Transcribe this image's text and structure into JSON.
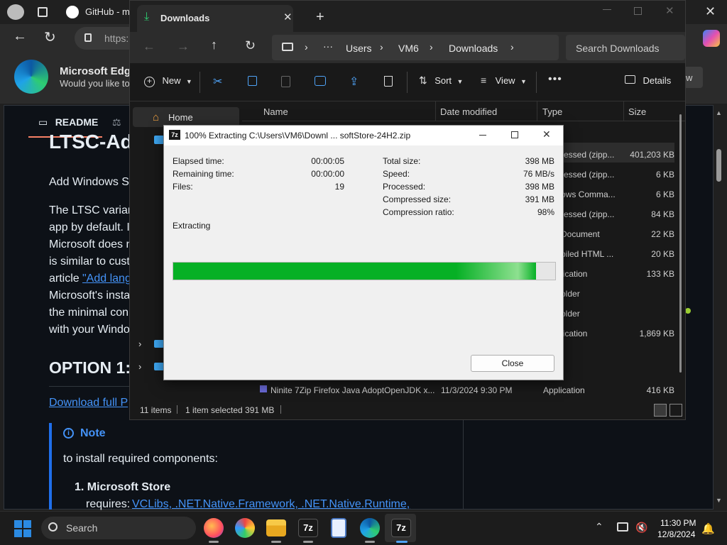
{
  "edge": {
    "tab_title": "GitHub - mi",
    "address": "https:",
    "promo_title": "Microsoft Edge",
    "promo_sub": "Would you like to",
    "promo_btn": "w"
  },
  "github": {
    "readme_tab": "README",
    "heading": "LTSC-Ad",
    "para1": "Add Windows St",
    "para2": [
      "The LTSC variant",
      "app by default. I",
      "Microsoft does n",
      "is similar to cust",
      "article",
      "Microsoft's insta",
      "the minimal con",
      "with your Windo"
    ],
    "link_add_lang": "\"Add lang",
    "option_heading": "OPTION 1:",
    "download_link": "Download full P",
    "note_label": "Note",
    "note_text": "to install required components:",
    "list_item": "1. Microsoft Store",
    "requires_label": "requires:",
    "requires_links": "VCLibs, .NET.Native.Framework, .NET.Native.Runtime,"
  },
  "explorer": {
    "tab_title": "Downloads",
    "breadcrumb": [
      "Users",
      "VM6",
      "Downloads"
    ],
    "search_placeholder": "Search Downloads",
    "toolbar": {
      "new": "New",
      "sort": "Sort",
      "view": "View",
      "details": "Details"
    },
    "columns": {
      "name": "Name",
      "date": "Date modified",
      "type": "Type",
      "size": "Size"
    },
    "nav_home": "Home",
    "rows": [
      {
        "type": "ressed (zipp...",
        "size": "401,203 KB"
      },
      {
        "type": "ressed (zipp...",
        "size": "6 KB"
      },
      {
        "type": "ows Comma...",
        "size": "6 KB"
      },
      {
        "type": "ressed (zipp...",
        "size": "84 KB"
      },
      {
        "type": "Document",
        "size": "22 KB"
      },
      {
        "type": "piled HTML ...",
        "size": "20 KB"
      },
      {
        "type": "lication",
        "size": "133 KB"
      },
      {
        "type": "older",
        "size": ""
      },
      {
        "type": "older",
        "size": ""
      },
      {
        "type": "lication",
        "size": "1,869 KB"
      }
    ],
    "last_row": {
      "name": "Ninite 7Zip Firefox Java AdoptOpenJDK x...",
      "date": "11/3/2024 9:30 PM",
      "type": "Application",
      "size": "416 KB"
    },
    "status": {
      "items": "11 items",
      "selected": "1 item selected  391 MB"
    }
  },
  "zip_dialog": {
    "title": "100% Extracting C:\\Users\\VM6\\Downl ... softStore-24H2.zip",
    "left_labels": [
      "Elapsed time:",
      "Remaining time:",
      "Files:"
    ],
    "left_values": [
      "00:00:05",
      "00:00:00",
      "19"
    ],
    "right_labels": [
      "Total size:",
      "Speed:",
      "Processed:",
      "Compressed size:",
      "Compression ratio:"
    ],
    "right_values": [
      "398 MB",
      "76 MB/s",
      "398 MB",
      "391 MB",
      "98%"
    ],
    "status": "Extracting",
    "progress": 0.95,
    "close_label": "Close"
  },
  "taskbar": {
    "search": "Search",
    "time": "11:30 PM",
    "date": "12/8/2024"
  },
  "colors": {
    "progress_green": "#06b025",
    "github_link": "#4493f8"
  }
}
